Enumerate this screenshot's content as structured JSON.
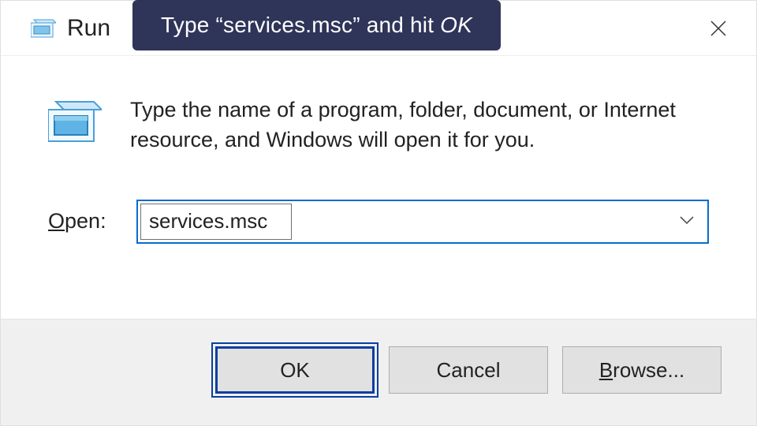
{
  "title": "Run",
  "tooltip": {
    "prefix": "Type “services.msc” and hit ",
    "emph": "OK"
  },
  "description": "Type the name of a program, folder, document, or Internet resource, and Windows will open it for you.",
  "open": {
    "label_accel": "O",
    "label_rest": "pen:",
    "value": "services.msc"
  },
  "buttons": {
    "ok": "OK",
    "cancel": "Cancel",
    "browse_accel": "B",
    "browse_rest": "rowse..."
  }
}
